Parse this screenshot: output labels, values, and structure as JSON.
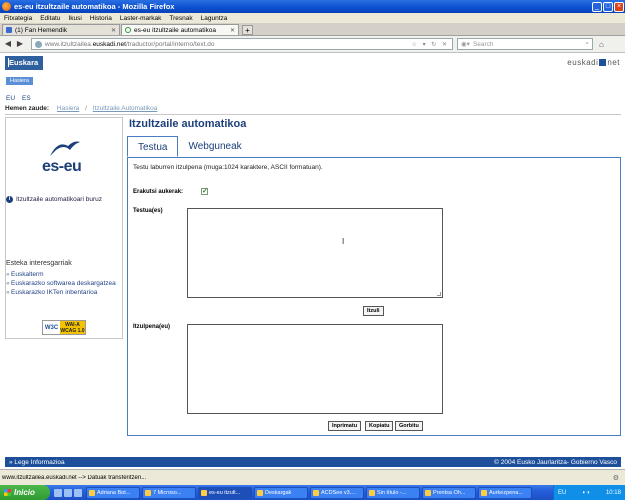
{
  "window": {
    "title": "es-eu itzultzaile automatikoa - Mozilla Firefox"
  },
  "menubar": [
    "Fitxategia",
    "Editatu",
    "Ikusi",
    "Historia",
    "Laster-markak",
    "Tresnak",
    "Laguntza"
  ],
  "tabs": [
    {
      "label": "(1) Fan Hemendik"
    },
    {
      "label": "es-eu itzultzaile automatikoa"
    }
  ],
  "nav": {
    "url_prefix": "www.itzultzailea.",
    "url_domain": "euskadi.net",
    "url_path": "/traductor/portal/interno/text.do",
    "search_placeholder": "Search"
  },
  "header": {
    "euskara_logo": "Euskara",
    "euskadi_logo_left": "euskadi",
    "euskadi_logo_right": "net",
    "home_button": "Hasiera",
    "lang_eu": "EU",
    "lang_es": "ES"
  },
  "breadcrumb": {
    "label": "Hemen zaude:",
    "home": "Hasiera",
    "separator": "/",
    "current": "Itzultzaile Automatikoa"
  },
  "sidebar": {
    "logo_text": "es-eu",
    "about": "Itzultzaile automatikoari buruz",
    "interest_title": "Esteka interesgarriak",
    "links": [
      "Euskalterm",
      "Euskarazko softwarea deskargatzea",
      "Euskarazko IKTen inbentarioa"
    ],
    "w3c": "W3C",
    "wai_line1": "WAI-A",
    "wai_line2": "WCAG 1.0"
  },
  "main": {
    "title": "Itzultzaile automatikoa",
    "tabs": [
      "Testua",
      "Webguneak"
    ],
    "description": "Testu laburren itzulpena (muga:1024 karaktere, ASCII formatuan).",
    "show_options_label": "Erakutsi aukerak:",
    "source_label": "Testua(es)",
    "translate_button": "Itzuli",
    "target_label": "Itzulpena(eu)",
    "print_button": "Inprimatu",
    "copy_button": "Kopiatu",
    "save_button": "Gorbitu"
  },
  "footer": {
    "left": "Lege Informazioa",
    "right": "© 2004 Eusko Jaurlaritza- Gobierno Vasco"
  },
  "statusbar": {
    "text": "www.itzultzailea.euskadi.net --> Datuak transferitzen..."
  },
  "taskbar": {
    "start": "Inicio",
    "tasks": [
      "Adriana Bot...",
      "7 Microso...",
      "es-eu itzult...",
      "Deskargak",
      "ACDSee v3....",
      "Sin título -...",
      "Prentsa Oh...",
      "Aurkezpena..."
    ],
    "lang": "EU",
    "time": "10:18"
  }
}
